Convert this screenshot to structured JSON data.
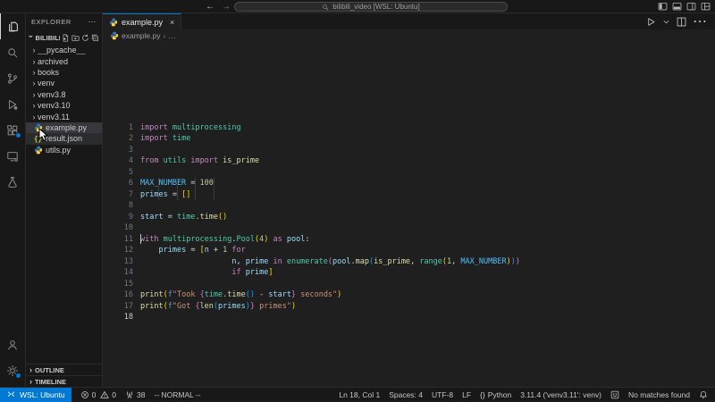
{
  "colors": {
    "accent_blue": "#0078d4",
    "editor_bg": "#1f1f1f",
    "chrome_bg": "#181818",
    "token_colors": {
      "kw": "#C586C0",
      "mod": "#4EC9B0",
      "fn": "#DCDCAA",
      "var": "#9CDCFE",
      "const": "#4FC1FF",
      "num": "#B5CEA8",
      "str": "#CE9178",
      "op": "#D4D4D4",
      "b1": "#FFD700",
      "b2": "#DA70D6",
      "b3": "#179FFF",
      "f": "#569CD6"
    }
  },
  "title_bar": {
    "back": "←",
    "forward": "→",
    "command_center": "bilibili_video [WSL: Ubuntu]",
    "layout_icons": [
      "layout-sidebar-left",
      "layout-panel-bottom",
      "layout-sidebar-right",
      "layout-customize"
    ]
  },
  "activity_bar": {
    "top": [
      {
        "icon": "files",
        "active": true
      },
      {
        "icon": "search"
      },
      {
        "icon": "source-control"
      },
      {
        "icon": "run-debug"
      },
      {
        "icon": "extensions",
        "badge": true
      },
      {
        "icon": "remote-explorer"
      },
      {
        "icon": "testing"
      }
    ],
    "bottom": [
      {
        "icon": "account"
      },
      {
        "icon": "settings",
        "badge": true
      }
    ]
  },
  "explorer": {
    "title": "EXPLORER",
    "more": "⋯",
    "section": {
      "label": "BILIBILI...",
      "actions": [
        "new-file",
        "new-folder",
        "refresh",
        "collapse-all"
      ]
    },
    "files": [
      {
        "label": "__pycache__",
        "kind": "folder"
      },
      {
        "label": "archived",
        "kind": "folder"
      },
      {
        "label": "books",
        "kind": "folder"
      },
      {
        "label": "venv",
        "kind": "folder"
      },
      {
        "label": "venv3.8",
        "kind": "folder"
      },
      {
        "label": "venv3.10",
        "kind": "folder"
      },
      {
        "label": "venv3.11",
        "kind": "folder"
      },
      {
        "label": "example.py",
        "kind": "python",
        "state": "selected"
      },
      {
        "label": "result.json",
        "kind": "json",
        "state": "hover"
      },
      {
        "label": "utils.py",
        "kind": "python"
      }
    ],
    "panels": [
      "OUTLINE",
      "TIMELINE"
    ]
  },
  "editor": {
    "tab": {
      "label": "example.py",
      "close": "×"
    },
    "actions": [
      "run",
      "chevron-down",
      "split-editor",
      "more"
    ],
    "breadcrumb": {
      "file": "example.py",
      "sep": "›",
      "more": "…"
    }
  },
  "code": {
    "lines": [
      {
        "n": "1",
        "t": [
          [
            "kw",
            "import"
          ],
          [
            "op",
            " "
          ],
          [
            "mod",
            "multiprocessing"
          ]
        ]
      },
      {
        "n": "2",
        "t": [
          [
            "kw",
            "import"
          ],
          [
            "op",
            " "
          ],
          [
            "mod",
            "time"
          ]
        ]
      },
      {
        "n": "3",
        "t": []
      },
      {
        "n": "4",
        "t": [
          [
            "kw",
            "from"
          ],
          [
            "op",
            " "
          ],
          [
            "mod",
            "utils"
          ],
          [
            "op",
            " "
          ],
          [
            "kw",
            "import"
          ],
          [
            "op",
            " "
          ],
          [
            "fn",
            "is_prime"
          ]
        ]
      },
      {
        "n": "5",
        "t": []
      },
      {
        "n": "6",
        "t": [
          [
            "const",
            "MAX_NUMBER"
          ],
          [
            "op",
            " = "
          ],
          [
            "num",
            "100"
          ]
        ]
      },
      {
        "n": "7",
        "t": [
          [
            "var",
            "primes"
          ],
          [
            "op",
            " = "
          ],
          [
            "b1",
            "[]"
          ]
        ]
      },
      {
        "n": "8",
        "t": []
      },
      {
        "n": "9",
        "t": [
          [
            "var",
            "start"
          ],
          [
            "op",
            " = "
          ],
          [
            "mod",
            "time"
          ],
          [
            "op",
            "."
          ],
          [
            "fn",
            "time"
          ],
          [
            "b1",
            "()"
          ]
        ]
      },
      {
        "n": "10",
        "t": []
      },
      {
        "n": "11",
        "t": [
          [
            "kw",
            "with"
          ],
          [
            "op",
            " "
          ],
          [
            "mod",
            "multiprocessing"
          ],
          [
            "op",
            "."
          ],
          [
            "mod",
            "Pool"
          ],
          [
            "b1",
            "("
          ],
          [
            "num",
            "4"
          ],
          [
            "b1",
            ")"
          ],
          [
            "op",
            " "
          ],
          [
            "kw",
            "as"
          ],
          [
            "op",
            " "
          ],
          [
            "var",
            "pool"
          ],
          [
            "op",
            ":"
          ]
        ]
      },
      {
        "n": "12",
        "t": [
          [
            "op",
            "    "
          ],
          [
            "var",
            "primes"
          ],
          [
            "op",
            " = "
          ],
          [
            "b1",
            "["
          ],
          [
            "var",
            "n"
          ],
          [
            "op",
            " + "
          ],
          [
            "num",
            "1"
          ],
          [
            "op",
            " "
          ],
          [
            "kw",
            "for"
          ]
        ]
      },
      {
        "n": "13",
        "t": [
          [
            "op",
            "                    "
          ],
          [
            "var",
            "n"
          ],
          [
            "op",
            ", "
          ],
          [
            "var",
            "prime"
          ],
          [
            "op",
            " "
          ],
          [
            "kw",
            "in"
          ],
          [
            "op",
            " "
          ],
          [
            "mod",
            "enumerate"
          ],
          [
            "b2",
            "("
          ],
          [
            "var",
            "pool"
          ],
          [
            "op",
            "."
          ],
          [
            "fn",
            "map"
          ],
          [
            "b3",
            "("
          ],
          [
            "fn",
            "is_prime"
          ],
          [
            "op",
            ", "
          ],
          [
            "mod",
            "range"
          ],
          [
            "b1",
            "("
          ],
          [
            "num",
            "1"
          ],
          [
            "op",
            ", "
          ],
          [
            "const",
            "MAX_NUMBER"
          ],
          [
            "b1",
            ")"
          ],
          [
            "b3",
            ")"
          ],
          [
            "b2",
            ")"
          ]
        ]
      },
      {
        "n": "14",
        "t": [
          [
            "op",
            "                    "
          ],
          [
            "kw",
            "if"
          ],
          [
            "op",
            " "
          ],
          [
            "var",
            "prime"
          ],
          [
            "b1",
            "]"
          ]
        ]
      },
      {
        "n": "15",
        "t": []
      },
      {
        "n": "16",
        "t": [
          [
            "fn",
            "print"
          ],
          [
            "b1",
            "("
          ],
          [
            "f",
            "f"
          ],
          [
            "str",
            "\"Took "
          ],
          [
            "b2",
            "{"
          ],
          [
            "mod",
            "time"
          ],
          [
            "op",
            "."
          ],
          [
            "fn",
            "time"
          ],
          [
            "b3",
            "()"
          ],
          [
            "op",
            " - "
          ],
          [
            "var",
            "start"
          ],
          [
            "b2",
            "}"
          ],
          [
            "str",
            " seconds\""
          ],
          [
            "b1",
            ")"
          ]
        ]
      },
      {
        "n": "17",
        "t": [
          [
            "fn",
            "print"
          ],
          [
            "b1",
            "("
          ],
          [
            "f",
            "f"
          ],
          [
            "str",
            "\"Got "
          ],
          [
            "b2",
            "{"
          ],
          [
            "fn",
            "len"
          ],
          [
            "b3",
            "("
          ],
          [
            "var",
            "primes"
          ],
          [
            "b3",
            ")"
          ],
          [
            "b2",
            "}"
          ],
          [
            "str",
            " primes\""
          ],
          [
            "b1",
            ")"
          ]
        ]
      },
      {
        "n": "18",
        "t": [],
        "current": true
      }
    ]
  },
  "status_bar": {
    "remote": {
      "icon": "remote",
      "label": "WSL: Ubuntu"
    },
    "left": [
      {
        "icon": "error",
        "label": "0"
      },
      {
        "icon": "warning",
        "label": "0",
        "tight": true
      },
      {
        "icon": "radio-tower",
        "label": "38"
      },
      {
        "label": "-- NORMAL --"
      }
    ],
    "right": [
      {
        "label": "Ln 18, Col 1"
      },
      {
        "label": "Spaces: 4"
      },
      {
        "label": "UTF-8"
      },
      {
        "label": "LF"
      },
      {
        "icon": "braces",
        "label": "Python"
      },
      {
        "label": "3.11.4 ('venv3.11': venv)"
      },
      {
        "icon": "smiley",
        "label": ""
      },
      {
        "label": "No matches found"
      },
      {
        "icon": "bell",
        "label": ""
      }
    ]
  }
}
